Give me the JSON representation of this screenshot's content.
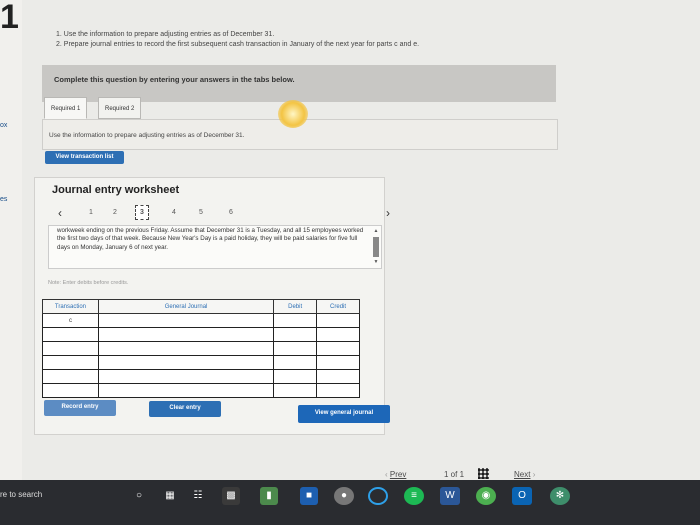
{
  "question_number": "1",
  "instructions": [
    "1. Use the information to prepare adjusting entries as of December 31.",
    "2. Prepare journal entries to record the first subsequent cash transaction in January of the next year for parts c and e."
  ],
  "banner_text": "Complete this question by entering your answers in the tabs below.",
  "tabs": [
    {
      "label": "Required 1"
    },
    {
      "label": "Required 2"
    }
  ],
  "tab_instruction": "Use the information to prepare adjusting entries as of December 31.",
  "view_transaction_label": "View transaction list",
  "worksheet": {
    "title": "Journal entry worksheet",
    "pages": [
      "1",
      "2",
      "3",
      "4",
      "5",
      "6"
    ],
    "active_page": "3",
    "description": "workweek ending on the previous Friday. Assume that December 31 is a Tuesday, and all 15 employees worked the first two days of that week. Because New Year's Day is a paid holiday, they will be paid salaries for five full days on Monday, January 6 of next year.",
    "note": "Note: Enter debits before credits.",
    "table": {
      "headers": [
        "Transaction",
        "General Journal",
        "Debit",
        "Credit"
      ],
      "rows": [
        [
          "c",
          "",
          "",
          ""
        ],
        [
          "",
          "",
          "",
          ""
        ],
        [
          "",
          "",
          "",
          ""
        ],
        [
          "",
          "",
          "",
          ""
        ],
        [
          "",
          "",
          "",
          ""
        ],
        [
          "",
          "",
          "",
          ""
        ]
      ]
    },
    "record_label": "Record entry",
    "clear_label": "Clear entry",
    "view_journal_label": "View general journal"
  },
  "pager": {
    "prev": "Prev",
    "position": "1 of 1",
    "next": "Next"
  },
  "left_marks": [
    "ox",
    "es"
  ],
  "taskbar": {
    "search_text": "re to search",
    "icons": [
      "cortana-icon",
      "task-view-icon",
      "calculator-icon",
      "file-explorer-icon",
      "sway-icon",
      "dell-icon",
      "cortana-ring-icon",
      "spotify-icon",
      "word-icon",
      "chrome-icon",
      "outlook-icon",
      "settings-icon"
    ]
  },
  "colors": {
    "accent_blue": "#2d6fb4",
    "view_journal_blue": "#1d67b8",
    "taskbar": "#2a2c30"
  }
}
